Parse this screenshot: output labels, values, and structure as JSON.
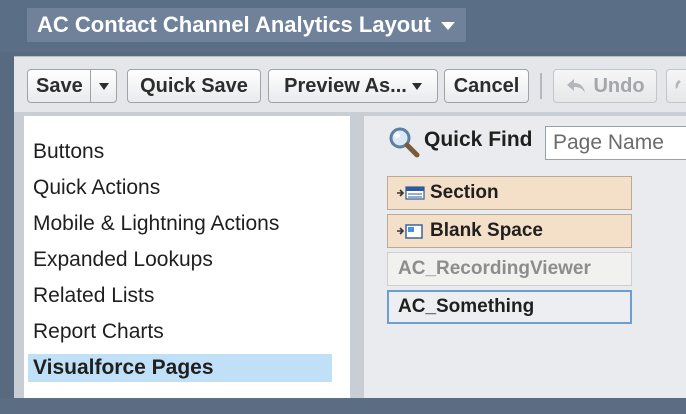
{
  "header": {
    "layout_title": "AC Contact Channel Analytics Layout"
  },
  "toolbar": {
    "save_label": "Save",
    "quick_save_label": "Quick Save",
    "preview_label": "Preview As...",
    "cancel_label": "Cancel",
    "undo_label": "Undo"
  },
  "categories": {
    "items": [
      {
        "label": "Buttons"
      },
      {
        "label": "Quick Actions"
      },
      {
        "label": "Mobile & Lightning Actions"
      },
      {
        "label": "Expanded Lookups"
      },
      {
        "label": "Related Lists"
      },
      {
        "label": "Report Charts"
      },
      {
        "label": "Visualforce Pages"
      }
    ],
    "selected": "Visualforce Pages"
  },
  "quick_find": {
    "label": "Quick Find",
    "placeholder": "Page Name"
  },
  "elements": {
    "items": [
      {
        "label": "Section",
        "icon": "section-icon"
      },
      {
        "label": "Blank Space",
        "icon": "blank-space-icon"
      },
      {
        "label": "AC_RecordingViewer",
        "state": "already-placed"
      },
      {
        "label": "AC_Something",
        "state": "selected"
      }
    ]
  },
  "colors": {
    "title_bar": "#5a6e86",
    "selected_category": "#bfe0f7",
    "layout_element": "#f4dfc8",
    "selection_border": "#6b9ed2"
  }
}
